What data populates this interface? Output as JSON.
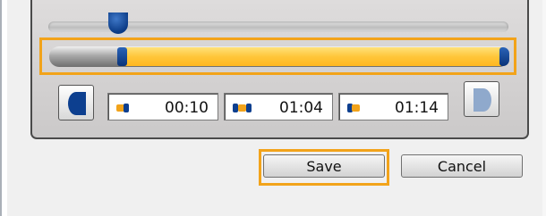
{
  "timeline": {
    "position_fraction": 0.14,
    "range_start_fraction": 0.14,
    "range_end_fraction": 1.0,
    "highlight_color": "#f2a31a",
    "fill_color": "#ffc63a",
    "thumb_color": "#0b3b86"
  },
  "time_fields": {
    "start": {
      "icon": "start-marker-icon",
      "value": "00:10"
    },
    "current": {
      "icon": "range-marker-icon",
      "value": "01:04"
    },
    "end": {
      "icon": "end-marker-icon",
      "value": "01:14"
    }
  },
  "buttons": {
    "set_start_icon": "set-start-bracket-icon",
    "set_end_icon": "set-end-bracket-icon",
    "save_label": "Save",
    "cancel_label": "Cancel"
  }
}
